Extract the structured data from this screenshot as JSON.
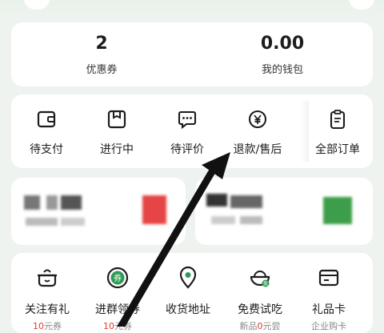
{
  "stats": [
    {
      "value": "2",
      "label": "优惠券"
    },
    {
      "value": "0.00",
      "label": "我的钱包"
    }
  ],
  "orders": [
    {
      "label": "待支付",
      "icon": "wallet-icon"
    },
    {
      "label": "进行中",
      "icon": "package-icon"
    },
    {
      "label": "待评价",
      "icon": "comment-icon"
    },
    {
      "label": "退款/售后",
      "icon": "refund-yen-icon"
    },
    {
      "label": "全部订单",
      "icon": "clipboard-icon"
    }
  ],
  "services": [
    {
      "label": "关注有礼",
      "sub_value": "10",
      "sub_unit": "元券",
      "icon": "gift-pot-icon"
    },
    {
      "label": "进群领券",
      "sub_value": "10",
      "sub_unit": "元券",
      "icon": "coupon-badge-icon"
    },
    {
      "label": "收货地址",
      "sub_value": "",
      "sub_unit": "",
      "icon": "location-pin-icon"
    },
    {
      "label": "免费试吃",
      "sub_prefix": "新品",
      "sub_value": "0",
      "sub_unit": "元尝",
      "icon": "bowl-icon"
    },
    {
      "label": "礼品卡",
      "sub_plain": "企业购卡",
      "icon": "gift-card-icon"
    }
  ],
  "colors": {
    "accent_green": "#2f9a55",
    "red": "#e23a2e",
    "background": "#eef3ef"
  }
}
